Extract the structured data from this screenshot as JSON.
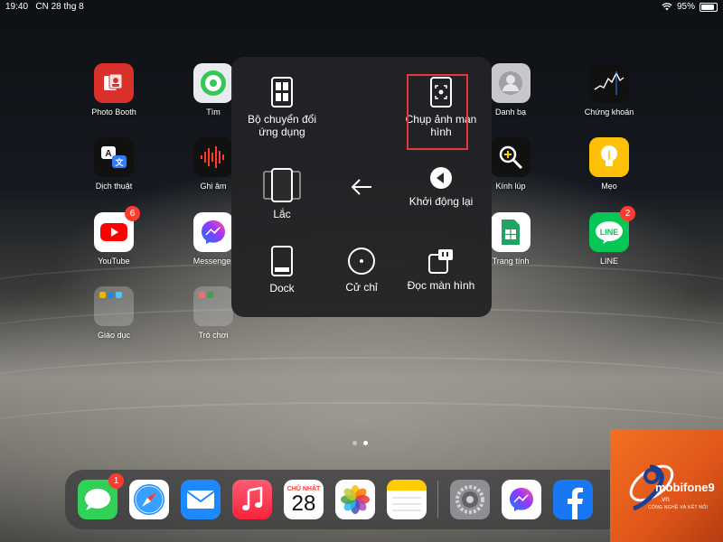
{
  "status": {
    "time": "19:40",
    "date": "CN 28 thg 8",
    "battery": "95%"
  },
  "apps": {
    "photo_booth": "Photo Booth",
    "tim": "Tìm",
    "danh_ba": "Danh bạ",
    "chung_khoan": "Chứng khoán",
    "dich_thuat": "Dịch thuật",
    "ghi_am": "Ghi âm",
    "kinh_lup": "Kính lúp",
    "meo": "Mẹo",
    "youtube": "YouTube",
    "youtube_badge": "6",
    "messenger": "Messenger",
    "trang_tinh": "Trang tính",
    "line": "LINE",
    "line_badge": "2",
    "giao_duc": "Giáo dục",
    "tro_choi": "Trò chơi"
  },
  "menu": {
    "app_switcher": "Bộ chuyển đổi ứng dụng",
    "screenshot": "Chụp ảnh màn hình",
    "shake": "Lắc",
    "restart": "Khởi động lại",
    "dock": "Dock",
    "gestures": "Cử chỉ",
    "speak_screen": "Đọc màn hình"
  },
  "dock": {
    "messages_badge": "1",
    "calendar_day": "CHỦ NHẬT",
    "calendar_date": "28"
  },
  "watermark": {
    "brand": "mobifone9",
    "sub": "CÔNG NGHỆ VÀ KẾT NỐI",
    "vn": ".vn"
  },
  "colors": {
    "highlight": "#e53935",
    "badge": "#ff3b30",
    "brand": "#f37021"
  }
}
